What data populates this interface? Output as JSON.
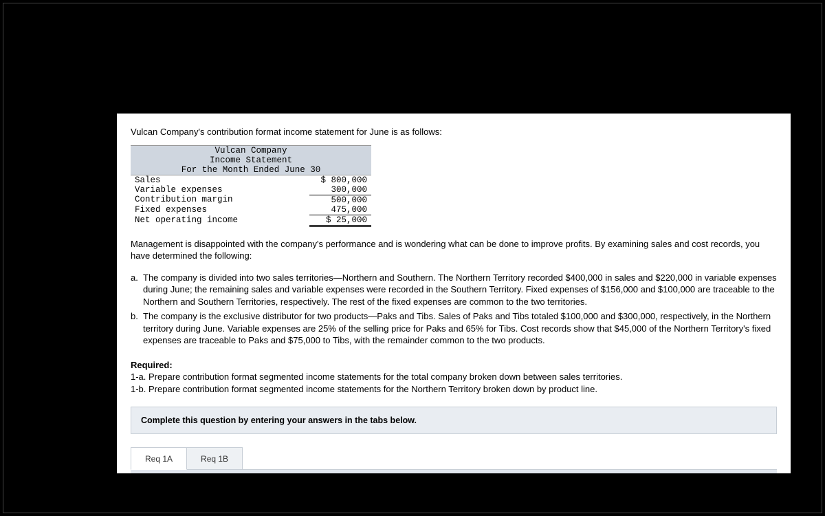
{
  "intro": "Vulcan Company's contribution format income statement for June is as follows:",
  "statement": {
    "company": "Vulcan Company",
    "title": "Income Statement",
    "period": "For the Month Ended June 30",
    "rows": [
      {
        "label": "Sales",
        "value": "$ 800,000"
      },
      {
        "label": "Variable expenses",
        "value": "300,000"
      },
      {
        "label": "Contribution margin",
        "value": "500,000"
      },
      {
        "label": "Fixed expenses",
        "value": "475,000"
      },
      {
        "label": "Net operating income",
        "value": "$ 25,000"
      }
    ]
  },
  "mgmt_para": "Management is disappointed with the company's performance and is wondering what can be done to improve profits. By examining sales and cost records, you have determined the following:",
  "items": {
    "a_label": "a.",
    "a_text": "The company is divided into two sales territories—Northern and Southern. The Northern Territory recorded $400,000 in sales and $220,000 in variable expenses during June; the remaining sales and variable expenses were recorded in the Southern Territory. Fixed expenses of $156,000 and $100,000 are traceable to the Northern and Southern Territories, respectively. The rest of the fixed expenses are common to the two territories.",
    "b_label": "b.",
    "b_text": "The company is the exclusive distributor for two products—Paks and Tibs. Sales of Paks and Tibs totaled $100,000 and $300,000, respectively, in the Northern territory during June. Variable expenses are 25% of the selling price for Paks and 65% for Tibs. Cost records show that $45,000 of the Northern Territory's fixed expenses are traceable to Paks and $75,000 to Tibs, with the remainder common to the two products."
  },
  "required": {
    "heading": "Required:",
    "line1": "1-a. Prepare contribution format segmented income statements for the total company broken down between sales territories.",
    "line2": "1-b. Prepare contribution format segmented income statements for the Northern Territory broken down by product line."
  },
  "instruction": "Complete this question by entering your answers in the tabs below.",
  "tabs": {
    "a": "Req 1A",
    "b": "Req 1B"
  }
}
